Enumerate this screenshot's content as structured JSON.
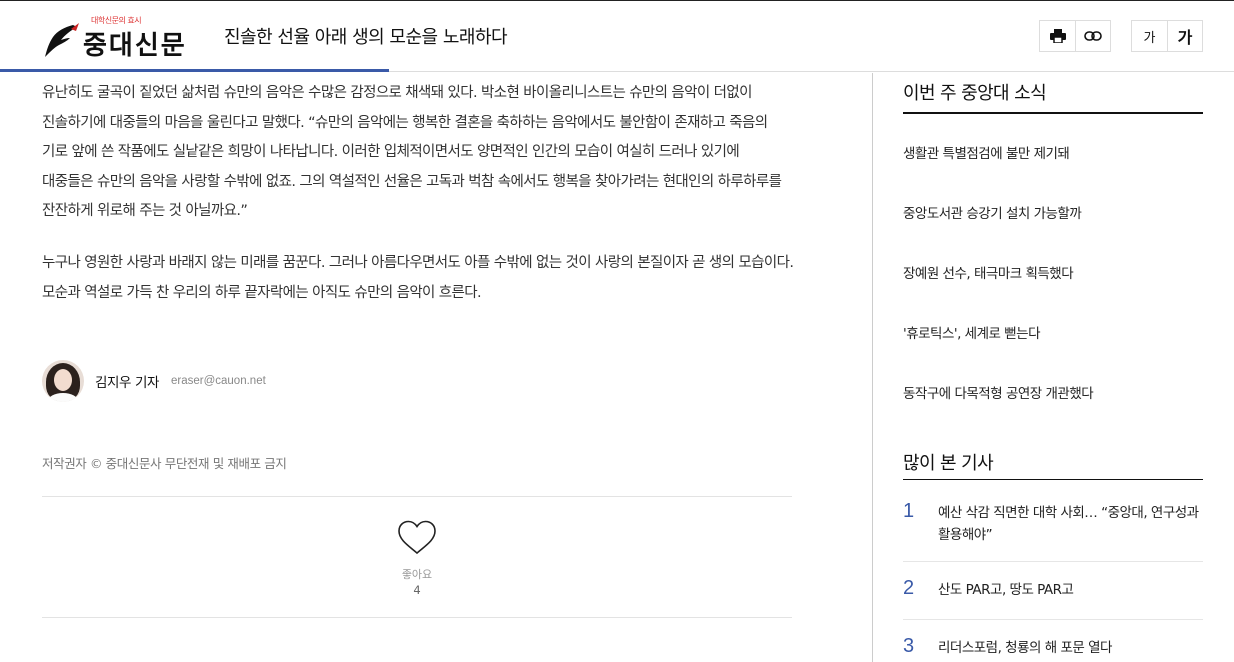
{
  "header": {
    "logo_tagline": "대학신문의 효시",
    "logo_text": "중대신문",
    "article_title": "진솔한 선율 아래 생의 모순을 노래하다",
    "reading_progress": 0.315,
    "font_small_label": "가",
    "font_large_label": "가"
  },
  "article": {
    "paragraphs": [
      "  유난히도 굴곡이 짙었던 삶처럼 슈만의 음악은 수많은 감정으로 채색돼 있다. 박소현 바이올리니스트는 슈만의 음악이 더없이 진솔하기에 대중들의 마음을 울린다고 말했다. “슈만의 음악에는 행복한 결혼을 축하하는 음악에서도 불안함이 존재하고 죽음의 기로 앞에 쓴 작품에도 실낱같은 희망이 나타납니다. 이러한 입체적이면서도 양면적인 인간의 모습이 여실히 드러나 있기에 대중들은 슈만의 음악을 사랑할 수밖에 없죠. 그의 역설적인 선율은 고독과 벅참 속에서도 행복을 찾아가려는 현대인의 하루하루를 잔잔하게 위로해 주는 것 아닐까요.”",
      "  누구나 영원한 사랑과 바래지 않는 미래를 꿈꾼다. 그러나 아름다우면서도 아플 수밖에 없는 것이 사랑의 본질이자 곧 생의 모습이다. 모순과 역설로 가득 찬 우리의 하루 끝자락에는 아직도 슈만의 음악이 흐른다."
    ],
    "author_name": "김지우 기자",
    "author_email": "eraser@cauon.net",
    "copyright": "저작권자 © 중대신문사 무단전재 및 재배포 금지",
    "like_label": "좋아요",
    "like_count": "4"
  },
  "sidebar": {
    "weekly_title": "이번 주 중앙대 소식",
    "weekly_items": [
      "생활관 특별점검에 불만 제기돼",
      "중앙도서관 승강기 설치 가능할까",
      "장예원 선수, 태극마크 획득했다",
      "'휴로틱스', 세계로 뻗는다",
      "동작구에 다목적형 공연장 개관했다"
    ],
    "popular_title": "많이 본 기사",
    "popular_items": [
      {
        "rank": "1",
        "title": "예산 삭감 직면한 대학 사회… “중앙대, 연구성과 활용해야”"
      },
      {
        "rank": "2",
        "title": "산도 PAR고, 땅도 PAR고"
      },
      {
        "rank": "3",
        "title": "리더스포럼, 청룡의 해 포문 열다"
      }
    ]
  },
  "icons": {
    "print": "print-icon",
    "link": "link-icon",
    "like": "heart-icon"
  },
  "colors": {
    "accent": "#3a5aa8",
    "logo_tagline": "#dd3333"
  }
}
